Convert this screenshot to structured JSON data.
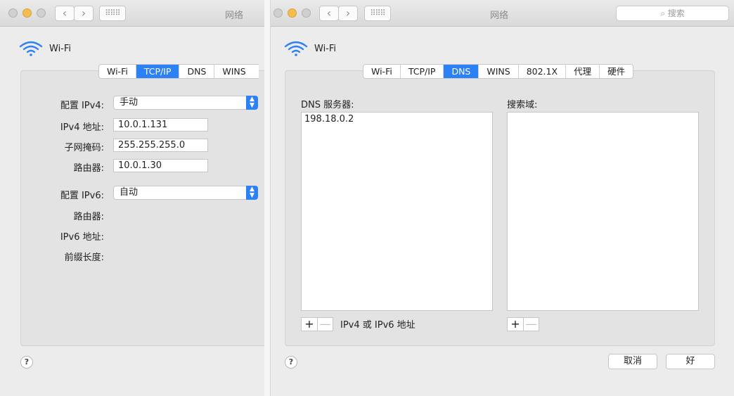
{
  "left": {
    "title": "网络",
    "wifi_label": "Wi-Fi",
    "tabs": [
      "Wi-Fi",
      "TCP/IP",
      "DNS",
      "WINS"
    ],
    "active_tab": "TCP/IP",
    "configure_ipv4_label": "配置 IPv4:",
    "configure_ipv4_value": "手动",
    "ipv4_address_label": "IPv4 地址:",
    "ipv4_address_value": "10.0.1.131",
    "subnet_label": "子网掩码:",
    "subnet_value": "255.255.255.0",
    "router_label": "路由器:",
    "router_value": "10.0.1.30",
    "configure_ipv6_label": "配置 IPv6:",
    "configure_ipv6_value": "自动",
    "router6_label": "路由器:",
    "ipv6_address_label": "IPv6 地址:",
    "prefix_label": "前缀长度:",
    "help": "?"
  },
  "right": {
    "title": "网络",
    "search_placeholder": "搜索",
    "wifi_label": "Wi-Fi",
    "tabs": [
      "Wi-Fi",
      "TCP/IP",
      "DNS",
      "WINS",
      "802.1X",
      "代理",
      "硬件"
    ],
    "active_tab": "DNS",
    "dns_servers_label": "DNS 服务器:",
    "dns_servers": [
      "198.18.0.2"
    ],
    "search_domains_label": "搜索域:",
    "plus": "+",
    "minus": "—",
    "ipv6_hint": "IPv4 或 IPv6 地址",
    "cancel": "取消",
    "ok": "好",
    "help": "?"
  },
  "colors": {
    "accent": "#2d81f7",
    "traffic_yellow": "#f5bd4f",
    "traffic_gray": "#d0d0d0"
  }
}
